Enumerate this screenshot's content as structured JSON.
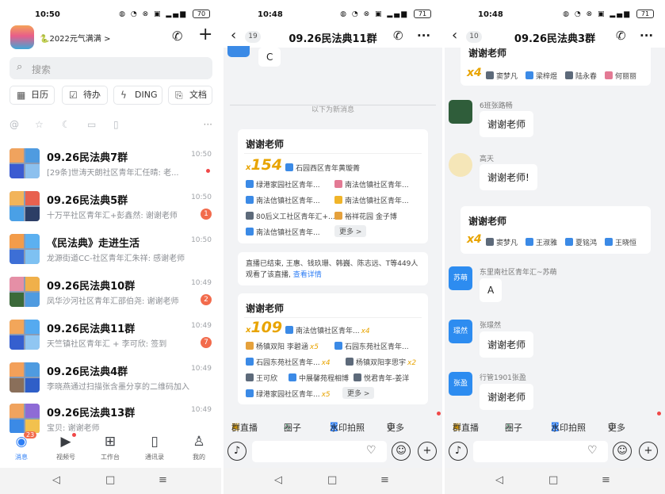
{
  "left": {
    "time": "10:50",
    "battery": "70",
    "org_name": "🐍2022元气满满",
    "org_chevron": ">",
    "search_placeholder": "搜索",
    "quick": [
      "日历",
      "待办",
      "DING",
      "文档"
    ],
    "filter_more": "···",
    "chats": [
      {
        "name": "09.26民法典7群",
        "preview": "[29条]世涛天朗社区青年汇任晴: 老...",
        "time": "10:50",
        "mark": "dot"
      },
      {
        "name": "09.26民法典5群",
        "preview": "十万平社区青年汇+彭鑫然: 谢谢老师",
        "time": "10:50",
        "mark": "1"
      },
      {
        "name": "《民法典》走进生活",
        "preview": "龙源街道CC-社区青年汇朱祥: 感谢老师",
        "time": "10:50",
        "mark": ""
      },
      {
        "name": "09.26民法典10群",
        "preview": "凤华沙河社区青年汇邵伯尧: 谢谢老师",
        "time": "10:49",
        "mark": "2"
      },
      {
        "name": "09.26民法典11群",
        "preview": "天竺镇社区青年汇 + 李可欣: 签到",
        "time": "10:49",
        "mark": "7"
      },
      {
        "name": "09.26民法典4群",
        "preview": "李晓燕通过扫描张含墨分享的二维码加入...",
        "time": "10:49",
        "mark": ""
      },
      {
        "name": "09.26民法典13群",
        "preview": "宝贝: 谢谢老师",
        "time": "10:49",
        "mark": ""
      }
    ],
    "tabs": [
      {
        "label": "消息",
        "icon": "message-icon",
        "badge": "23"
      },
      {
        "label": "视频号",
        "icon": "video-icon",
        "badge": ""
      },
      {
        "label": "工作台",
        "icon": "grid-icon",
        "badge": ""
      },
      {
        "label": "通讯录",
        "icon": "contacts-icon",
        "badge": ""
      },
      {
        "label": "我的",
        "icon": "profile-icon",
        "badge": ""
      }
    ]
  },
  "mid": {
    "time": "10:48",
    "battery": "71",
    "back_count": "19",
    "title": "09.26民法典11群",
    "top_bubble": "C",
    "new_divider": "以下为新消息",
    "card1": {
      "header": "谢谢老师",
      "count_prefix": "x",
      "count": "154",
      "top_tag": "石园西区青年黄璇菁",
      "tags": [
        "绿港家园社区青年...",
        "南法信镇社区青年...",
        "南法信镇社区青年...",
        "南法信镇社区青年...",
        "80后义工社区青年汇+...",
        "裕祥花园 金子博",
        "南法信镇社区青年..."
      ],
      "more": "更多 >"
    },
    "live_notice": "直播已结束, 王惠、钱玖珊、韩巍、陈志远、T等449人观看了该直播,",
    "live_link": "查看详情",
    "card2": {
      "header": "谢谢老师",
      "count_prefix": "x",
      "count": "109",
      "top_tag": "南法信镇社区青年...",
      "top_mult": "x4",
      "tags": [
        "杨镇双阳 李碧涵",
        "x5",
        "石园东苑社区青年...",
        "石园东苑社区青年...",
        "x4",
        "杨镇双阳李思宇",
        "x2",
        "王可欣",
        "中展馨苑程相博",
        "悦君青年-姜洋",
        "绿港家园社区青年...",
        "x5"
      ],
      "more": "更多 >"
    },
    "toolbar": [
      "群直播",
      "圈子",
      "水印拍照",
      "更多"
    ]
  },
  "right": {
    "time": "10:48",
    "battery": "71",
    "back_count": "10",
    "title": "09.26民法典3群",
    "top_card": {
      "header": "谢谢老师",
      "mult": "x4",
      "names": [
        "窦梦凡",
        "梁梓煜",
        "陆永春",
        "何丽丽"
      ]
    },
    "messages": [
      {
        "sender": "6班张路畅",
        "avatar_text": "",
        "text": "谢谢老师"
      },
      {
        "sender": "高天",
        "avatar_text": "",
        "text": "谢谢老师!"
      }
    ],
    "card": {
      "header": "谢谢老师",
      "mult": "x4",
      "names": [
        "窦梦凡",
        "王淑雅",
        "夏铭鸿",
        "王晓恒"
      ]
    },
    "messages2": [
      {
        "sender": "东里南社区青年汇~苏萌",
        "avatar_text": "苏萌",
        "text": "A"
      },
      {
        "sender": "张璟然",
        "avatar_text": "璟然",
        "text": "谢谢老师"
      },
      {
        "sender": "行管1901张盈",
        "avatar_text": "张盈",
        "text": "谢谢老师"
      }
    ],
    "toolbar": [
      "群直播",
      "圈子",
      "水印拍照",
      "更多"
    ]
  }
}
